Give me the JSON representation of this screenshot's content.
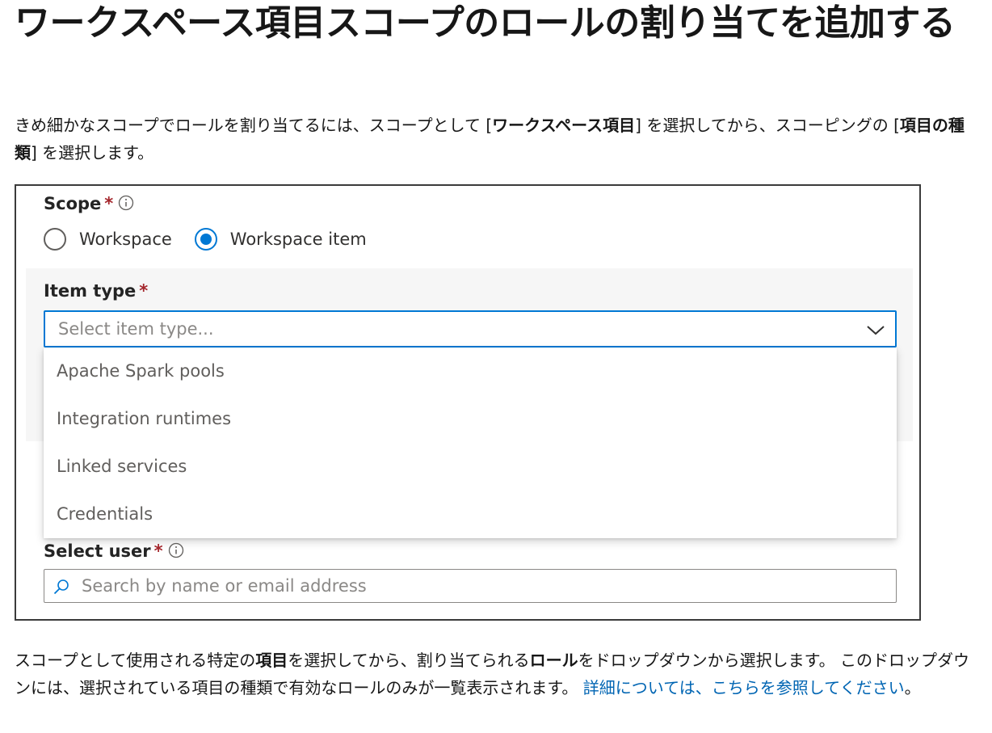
{
  "heading": "ワークスペース項目スコープのロールの割り当てを追加する",
  "intro": {
    "part1": "きめ細かなスコープでロールを割り当てるには、スコープとして [",
    "bold1": "ワークスペース項目",
    "part2": "] を選択してから、スコーピングの [",
    "bold2": "項目の種類",
    "part3": "] を選択します。"
  },
  "form": {
    "scope": {
      "label": "Scope",
      "required_mark": "*",
      "options": [
        {
          "label": "Workspace",
          "checked": false
        },
        {
          "label": "Workspace item",
          "checked": true
        }
      ]
    },
    "item_type": {
      "label": "Item type",
      "required_mark": "*",
      "placeholder": "Select item type...",
      "dropdown_options": [
        "Apache Spark pools",
        "Integration runtimes",
        "Linked services",
        "Credentials"
      ]
    },
    "select_user": {
      "label": "Select user",
      "required_mark": "*",
      "placeholder": "Search by name or email address"
    }
  },
  "outro": {
    "part1": "スコープとして使用される特定の",
    "bold1": "項目",
    "part2": "を選択してから、割り当てられる",
    "bold2": "ロール",
    "part3": "をドロップダウンから選択します。 このドロップダウンには、選択されている項目の種類で有効なロールのみが一覧表示されます。 ",
    "link": "詳細については、こちらを参照してください",
    "part4": "。"
  },
  "colors": {
    "accent": "#0078d4",
    "required": "#a4262c",
    "link": "#0065b3"
  },
  "icons": {
    "info": "info-icon",
    "chevron": "chevron-down-icon",
    "search": "search-icon"
  }
}
